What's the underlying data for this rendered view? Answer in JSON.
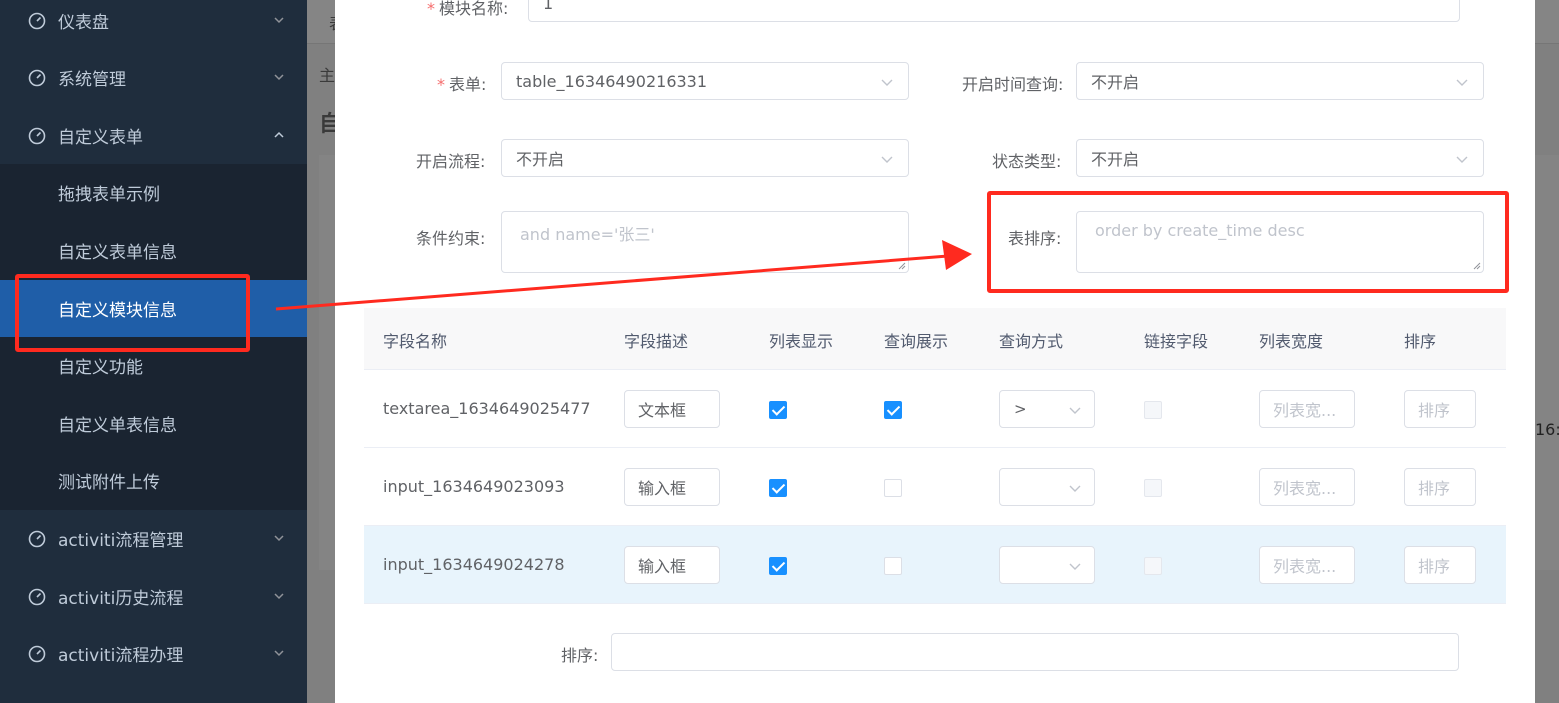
{
  "sidebar": {
    "items": [
      {
        "label": "仪表盘"
      },
      {
        "label": "系统管理"
      },
      {
        "label": "自定义表单"
      }
    ],
    "submenu": [
      {
        "label": "拖拽表单示例"
      },
      {
        "label": "自定义表单信息"
      },
      {
        "label": "自定义模块信息"
      },
      {
        "label": "自定义功能"
      },
      {
        "label": "自定义单表信息"
      },
      {
        "label": "测试附件上传"
      }
    ],
    "more": [
      {
        "label": "activiti流程管理"
      },
      {
        "label": "activiti历史流程"
      },
      {
        "label": "activiti流程办理"
      }
    ]
  },
  "background": {
    "tab_fragment": "表",
    "breadcrumb_fragment": "主",
    "title_fragment": "自",
    "time_fragment": "16:"
  },
  "form": {
    "module_name": {
      "label": "模块名称:",
      "value": "1"
    },
    "table": {
      "label": "表单:",
      "value": "table_16346490216331"
    },
    "time_query": {
      "label": "开启时间查询:",
      "value": "不开启"
    },
    "workflow": {
      "label": "开启流程:",
      "value": "不开启"
    },
    "status_type": {
      "label": "状态类型:",
      "value": "不开启"
    },
    "condition": {
      "label": "条件约束:",
      "placeholder": "and name='张三'"
    },
    "table_sort": {
      "label": "表排序:",
      "placeholder": "order by create_time desc"
    },
    "sort": {
      "label": "排序:",
      "value": ""
    }
  },
  "table": {
    "headers": [
      "字段名称",
      "字段描述",
      "列表显示",
      "查询展示",
      "查询方式",
      "链接字段",
      "列表宽度",
      "排序"
    ],
    "rows": [
      {
        "name": "textarea_1634649025477",
        "desc": "文本框",
        "list_show": true,
        "query_show": true,
        "query_mode": ">",
        "link": false,
        "width_placeholder": "列表宽...",
        "sort_placeholder": "排序"
      },
      {
        "name": "input_1634649023093",
        "desc": "输入框",
        "list_show": true,
        "query_show": false,
        "query_mode": "",
        "link": false,
        "width_placeholder": "列表宽...",
        "sort_placeholder": "排序"
      },
      {
        "name": "input_1634649024278",
        "desc": "输入框",
        "list_show": true,
        "query_show": false,
        "query_mode": "",
        "link": false,
        "width_placeholder": "列表宽...",
        "sort_placeholder": "排序"
      }
    ]
  },
  "colors": {
    "sidebar_bg": "#1f2d3d",
    "active_item": "#1f5ea8",
    "checkbox_on": "#1890ff",
    "annotation_red": "#ff2a1f"
  }
}
